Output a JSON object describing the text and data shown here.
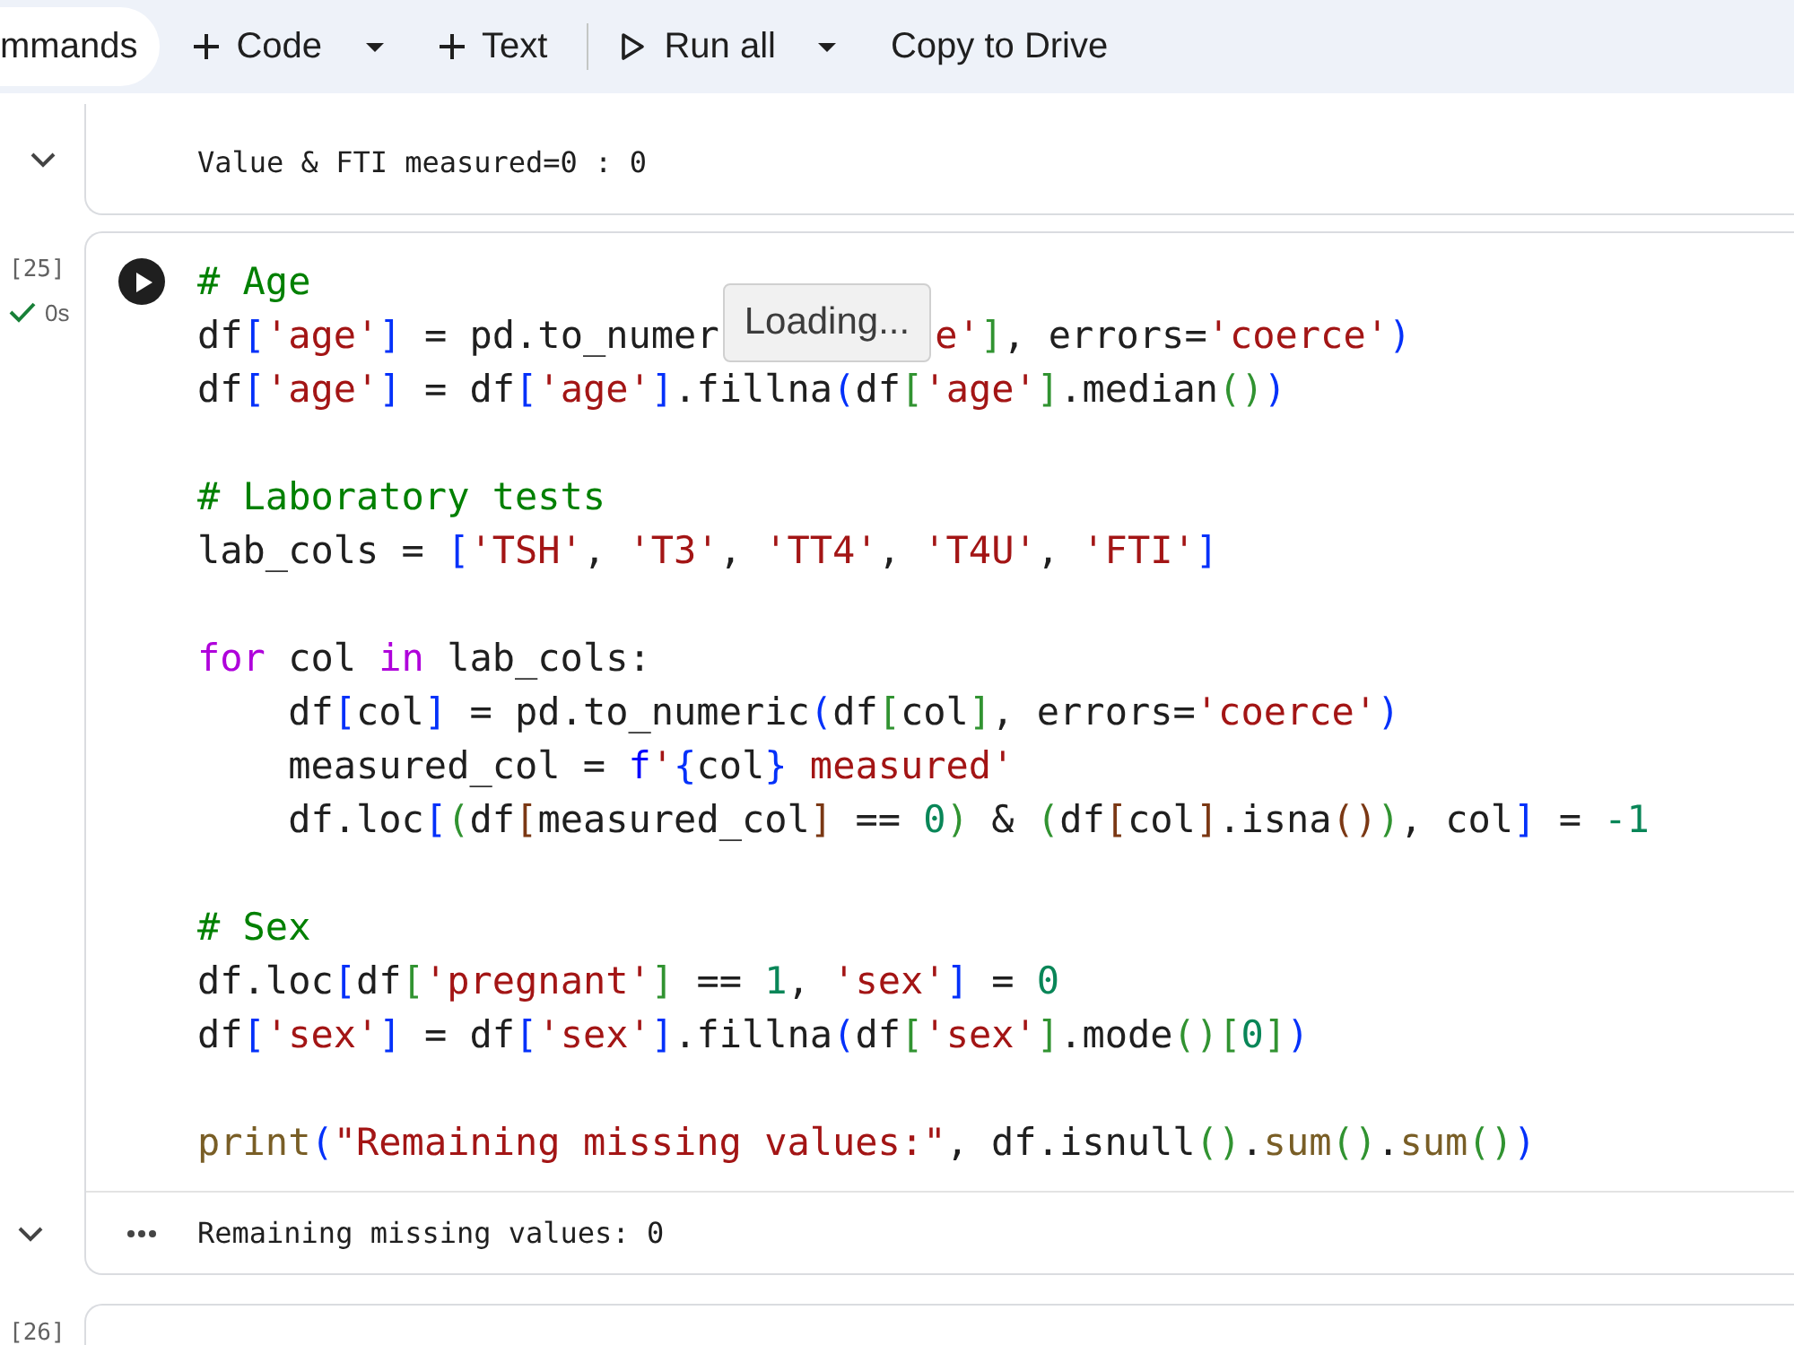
{
  "toolbar": {
    "items": [
      {
        "kind": "pill",
        "label": "mmands"
      },
      {
        "kind": "add",
        "label": "Code"
      },
      {
        "kind": "caret"
      },
      {
        "kind": "add",
        "label": "Text"
      },
      {
        "kind": "divider"
      },
      {
        "kind": "run",
        "label": "Run all"
      },
      {
        "kind": "caret"
      },
      {
        "kind": "plain",
        "label": "Copy to Drive"
      }
    ]
  },
  "cells": [
    {
      "kind": "output_only",
      "output": "Value & FTI measured=0 : 0"
    },
    {
      "kind": "code",
      "execution_count": "[25]",
      "status": "0s",
      "code": [
        {
          "kind": "line",
          "tokens": [
            {
              "text": "# Age",
              "kind": "comment"
            }
          ]
        },
        {
          "kind": "line",
          "tokens": [
            {
              "text": "df",
              "kind": "plain"
            },
            {
              "text": "[",
              "kind": "bracket1"
            },
            {
              "text": "'age'",
              "kind": "string"
            },
            {
              "text": "]",
              "kind": "bracket1"
            },
            {
              "text": " = pd.to_numer",
              "kind": "plain"
            },
            {
              "text": "Loading...",
              "kind": "tooltip"
            },
            {
              "text": "e'",
              "kind": "string"
            },
            {
              "text": "]",
              "kind": "bracket2"
            },
            {
              "text": ", errors=",
              "kind": "plain"
            },
            {
              "text": "'coerce'",
              "kind": "string"
            },
            {
              "text": ")",
              "kind": "bracket1"
            }
          ]
        },
        {
          "kind": "line",
          "tokens": [
            {
              "text": "df",
              "kind": "plain"
            },
            {
              "text": "[",
              "kind": "bracket1"
            },
            {
              "text": "'age'",
              "kind": "string"
            },
            {
              "text": "]",
              "kind": "bracket1"
            },
            {
              "text": " = df",
              "kind": "plain"
            },
            {
              "text": "[",
              "kind": "bracket1"
            },
            {
              "text": "'age'",
              "kind": "string"
            },
            {
              "text": "]",
              "kind": "bracket1"
            },
            {
              "text": ".fillna",
              "kind": "plain"
            },
            {
              "text": "(",
              "kind": "bracket1"
            },
            {
              "text": "df",
              "kind": "plain"
            },
            {
              "text": "[",
              "kind": "bracket2"
            },
            {
              "text": "'age'",
              "kind": "string"
            },
            {
              "text": "]",
              "kind": "bracket2"
            },
            {
              "text": ".median",
              "kind": "plain"
            },
            {
              "text": "(",
              "kind": "bracket2"
            },
            {
              "text": ")",
              "kind": "bracket2"
            },
            {
              "text": ")",
              "kind": "bracket1"
            }
          ]
        },
        {
          "kind": "blank"
        },
        {
          "kind": "line",
          "tokens": [
            {
              "text": "# Laboratory tests",
              "kind": "comment"
            }
          ]
        },
        {
          "kind": "line",
          "tokens": [
            {
              "text": "lab_cols = ",
              "kind": "plain"
            },
            {
              "text": "[",
              "kind": "bracket1"
            },
            {
              "text": "'TSH'",
              "kind": "string"
            },
            {
              "text": ", ",
              "kind": "plain"
            },
            {
              "text": "'T3'",
              "kind": "string"
            },
            {
              "text": ", ",
              "kind": "plain"
            },
            {
              "text": "'TT4'",
              "kind": "string"
            },
            {
              "text": ", ",
              "kind": "plain"
            },
            {
              "text": "'T4U'",
              "kind": "string"
            },
            {
              "text": ", ",
              "kind": "plain"
            },
            {
              "text": "'FTI'",
              "kind": "string"
            },
            {
              "text": "]",
              "kind": "bracket1"
            }
          ]
        },
        {
          "kind": "blank"
        },
        {
          "kind": "line",
          "tokens": [
            {
              "text": "for",
              "kind": "keyword"
            },
            {
              "text": " col ",
              "kind": "plain"
            },
            {
              "text": "in",
              "kind": "keyword"
            },
            {
              "text": " lab_cols:",
              "kind": "plain"
            }
          ]
        },
        {
          "kind": "line",
          "tokens": [
            {
              "text": "    df",
              "kind": "plain"
            },
            {
              "text": "[",
              "kind": "bracket1"
            },
            {
              "text": "col",
              "kind": "plain"
            },
            {
              "text": "]",
              "kind": "bracket1"
            },
            {
              "text": " = pd.to_numeric",
              "kind": "plain"
            },
            {
              "text": "(",
              "kind": "bracket1"
            },
            {
              "text": "df",
              "kind": "plain"
            },
            {
              "text": "[",
              "kind": "bracket2"
            },
            {
              "text": "col",
              "kind": "plain"
            },
            {
              "text": "]",
              "kind": "bracket2"
            },
            {
              "text": ", errors=",
              "kind": "plain"
            },
            {
              "text": "'coerce'",
              "kind": "string"
            },
            {
              "text": ")",
              "kind": "bracket1"
            }
          ]
        },
        {
          "kind": "line",
          "tokens": [
            {
              "text": "    measured_col = ",
              "kind": "plain"
            },
            {
              "text": "f",
              "kind": "prefix"
            },
            {
              "text": "'",
              "kind": "string"
            },
            {
              "text": "{",
              "kind": "bracket1"
            },
            {
              "text": "col",
              "kind": "plain"
            },
            {
              "text": "}",
              "kind": "bracket1"
            },
            {
              "text": " measured'",
              "kind": "string"
            }
          ]
        },
        {
          "kind": "line",
          "tokens": [
            {
              "text": "    df.loc",
              "kind": "plain"
            },
            {
              "text": "[",
              "kind": "bracket1"
            },
            {
              "text": "(",
              "kind": "bracket2"
            },
            {
              "text": "df",
              "kind": "plain"
            },
            {
              "text": "[",
              "kind": "bracket3"
            },
            {
              "text": "measured_col",
              "kind": "plain"
            },
            {
              "text": "]",
              "kind": "bracket3"
            },
            {
              "text": " == ",
              "kind": "plain"
            },
            {
              "text": "0",
              "kind": "number"
            },
            {
              "text": ")",
              "kind": "bracket2"
            },
            {
              "text": " & ",
              "kind": "plain"
            },
            {
              "text": "(",
              "kind": "bracket2"
            },
            {
              "text": "df",
              "kind": "plain"
            },
            {
              "text": "[",
              "kind": "bracket3"
            },
            {
              "text": "col",
              "kind": "plain"
            },
            {
              "text": "]",
              "kind": "bracket3"
            },
            {
              "text": ".isna",
              "kind": "plain"
            },
            {
              "text": "(",
              "kind": "bracket3"
            },
            {
              "text": ")",
              "kind": "bracket3"
            },
            {
              "text": ")",
              "kind": "bracket2"
            },
            {
              "text": ", col",
              "kind": "plain"
            },
            {
              "text": "]",
              "kind": "bracket1"
            },
            {
              "text": " = ",
              "kind": "plain"
            },
            {
              "text": "-1",
              "kind": "number"
            }
          ]
        },
        {
          "kind": "blank"
        },
        {
          "kind": "line",
          "tokens": [
            {
              "text": "# Sex",
              "kind": "comment"
            }
          ]
        },
        {
          "kind": "line",
          "tokens": [
            {
              "text": "df.loc",
              "kind": "plain"
            },
            {
              "text": "[",
              "kind": "bracket1"
            },
            {
              "text": "df",
              "kind": "plain"
            },
            {
              "text": "[",
              "kind": "bracket2"
            },
            {
              "text": "'pregnant'",
              "kind": "string"
            },
            {
              "text": "]",
              "kind": "bracket2"
            },
            {
              "text": " == ",
              "kind": "plain"
            },
            {
              "text": "1",
              "kind": "number"
            },
            {
              "text": ", ",
              "kind": "plain"
            },
            {
              "text": "'sex'",
              "kind": "string"
            },
            {
              "text": "]",
              "kind": "bracket1"
            },
            {
              "text": " = ",
              "kind": "plain"
            },
            {
              "text": "0",
              "kind": "number"
            }
          ]
        },
        {
          "kind": "line",
          "tokens": [
            {
              "text": "df",
              "kind": "plain"
            },
            {
              "text": "[",
              "kind": "bracket1"
            },
            {
              "text": "'sex'",
              "kind": "string"
            },
            {
              "text": "]",
              "kind": "bracket1"
            },
            {
              "text": " = df",
              "kind": "plain"
            },
            {
              "text": "[",
              "kind": "bracket1"
            },
            {
              "text": "'sex'",
              "kind": "string"
            },
            {
              "text": "]",
              "kind": "bracket1"
            },
            {
              "text": ".fillna",
              "kind": "plain"
            },
            {
              "text": "(",
              "kind": "bracket1"
            },
            {
              "text": "df",
              "kind": "plain"
            },
            {
              "text": "[",
              "kind": "bracket2"
            },
            {
              "text": "'sex'",
              "kind": "string"
            },
            {
              "text": "]",
              "kind": "bracket2"
            },
            {
              "text": ".mode",
              "kind": "plain"
            },
            {
              "text": "(",
              "kind": "bracket2"
            },
            {
              "text": ")",
              "kind": "bracket2"
            },
            {
              "text": "[",
              "kind": "bracket2"
            },
            {
              "text": "0",
              "kind": "number"
            },
            {
              "text": "]",
              "kind": "bracket2"
            },
            {
              "text": ")",
              "kind": "bracket1"
            }
          ]
        },
        {
          "kind": "blank"
        },
        {
          "kind": "line",
          "tokens": [
            {
              "text": "print",
              "kind": "function"
            },
            {
              "text": "(",
              "kind": "bracket1"
            },
            {
              "text": "\"Remaining missing values:\"",
              "kind": "string"
            },
            {
              "text": ", df.isnull",
              "kind": "plain"
            },
            {
              "text": "(",
              "kind": "bracket2"
            },
            {
              "text": ")",
              "kind": "bracket2"
            },
            {
              "text": ".",
              "kind": "plain"
            },
            {
              "text": "sum",
              "kind": "function"
            },
            {
              "text": "(",
              "kind": "bracket2"
            },
            {
              "text": ")",
              "kind": "bracket2"
            },
            {
              "text": ".",
              "kind": "plain"
            },
            {
              "text": "sum",
              "kind": "function"
            },
            {
              "text": "(",
              "kind": "bracket2"
            },
            {
              "text": ")",
              "kind": "bracket2"
            },
            {
              "text": ")",
              "kind": "bracket1"
            }
          ]
        }
      ],
      "output": "Remaining missing values: 0"
    },
    {
      "kind": "empty",
      "execution_count": "[26]"
    }
  ]
}
